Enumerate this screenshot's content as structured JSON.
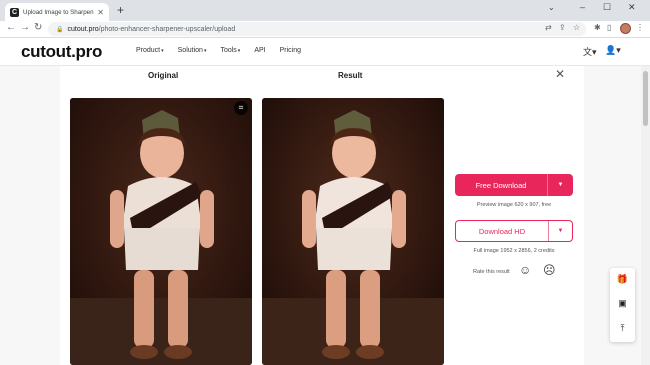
{
  "browser": {
    "tab_title": "Upload Image to Sharpen & Up",
    "tab_favicon_letter": "C",
    "url_domain": "cutout.pro",
    "url_path": "/photo-enhancer-sharpener-upscaler/upload"
  },
  "site": {
    "logo": "cutout.pro",
    "nav": [
      {
        "label": "Product",
        "caret": "▾"
      },
      {
        "label": "Solution",
        "caret": "▾"
      },
      {
        "label": "Tools",
        "caret": "▾"
      },
      {
        "label": "API",
        "caret": ""
      },
      {
        "label": "Pricing",
        "caret": ""
      }
    ]
  },
  "compare": {
    "original_title": "Original",
    "result_title": "Result"
  },
  "download": {
    "free_label": "Free Download",
    "free_caption": "Preview image 620 x 907, free",
    "hd_label": "Download HD",
    "hd_caption": "Full image 1952 x 2856, 2 credits"
  },
  "rating": {
    "label": "Rate this result"
  },
  "icons": {
    "translate": "translate-icon",
    "user": "user-icon",
    "close": "close-icon",
    "crop": "crop-icon",
    "gift": "gift-icon",
    "feedback": "feedback-icon",
    "to_top": "scroll-top-icon"
  },
  "colors": {
    "accent": "#e8265c"
  }
}
